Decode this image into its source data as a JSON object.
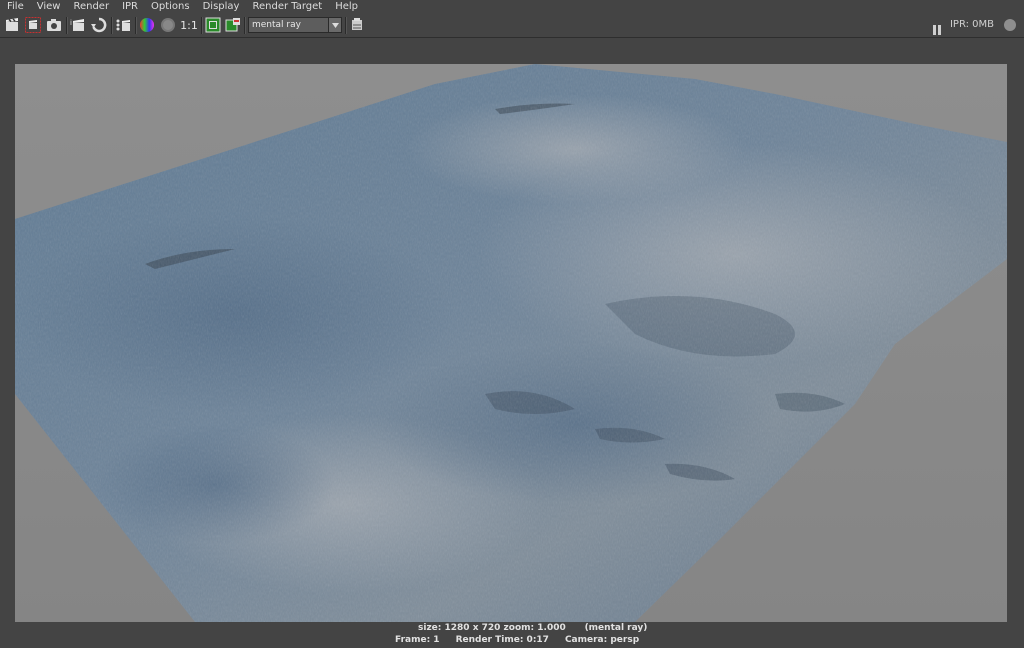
{
  "menu": {
    "items": [
      "File",
      "View",
      "Render",
      "IPR",
      "Options",
      "Display",
      "Render Target",
      "Help"
    ]
  },
  "toolbar": {
    "ratio_label": "1:1",
    "renderer": "mental ray",
    "ipr_status": "IPR: 0MB",
    "icons": [
      "render-frame-icon",
      "render-region-icon",
      "snapshot-icon",
      "ipr-render-icon",
      "refresh-ipr-icon",
      "render-sequence-icon",
      "rgb-channels-icon",
      "alpha-channel-icon",
      "real-size-icon",
      "keep-image-icon",
      "remove-image-icon",
      "renderer-dropdown-icon",
      "render-settings-icon"
    ]
  },
  "status": {
    "size_zoom": "size: 1280 x 720 zoom: 1.000",
    "renderer": "(mental ray)",
    "frame": "Frame: 1",
    "render_time": "Render Time: 0:17",
    "camera": "Camera: persp"
  },
  "colors": {
    "ui_background": "#444444",
    "render_background": "#8a8a8a",
    "water_blue": "#5a7590"
  }
}
